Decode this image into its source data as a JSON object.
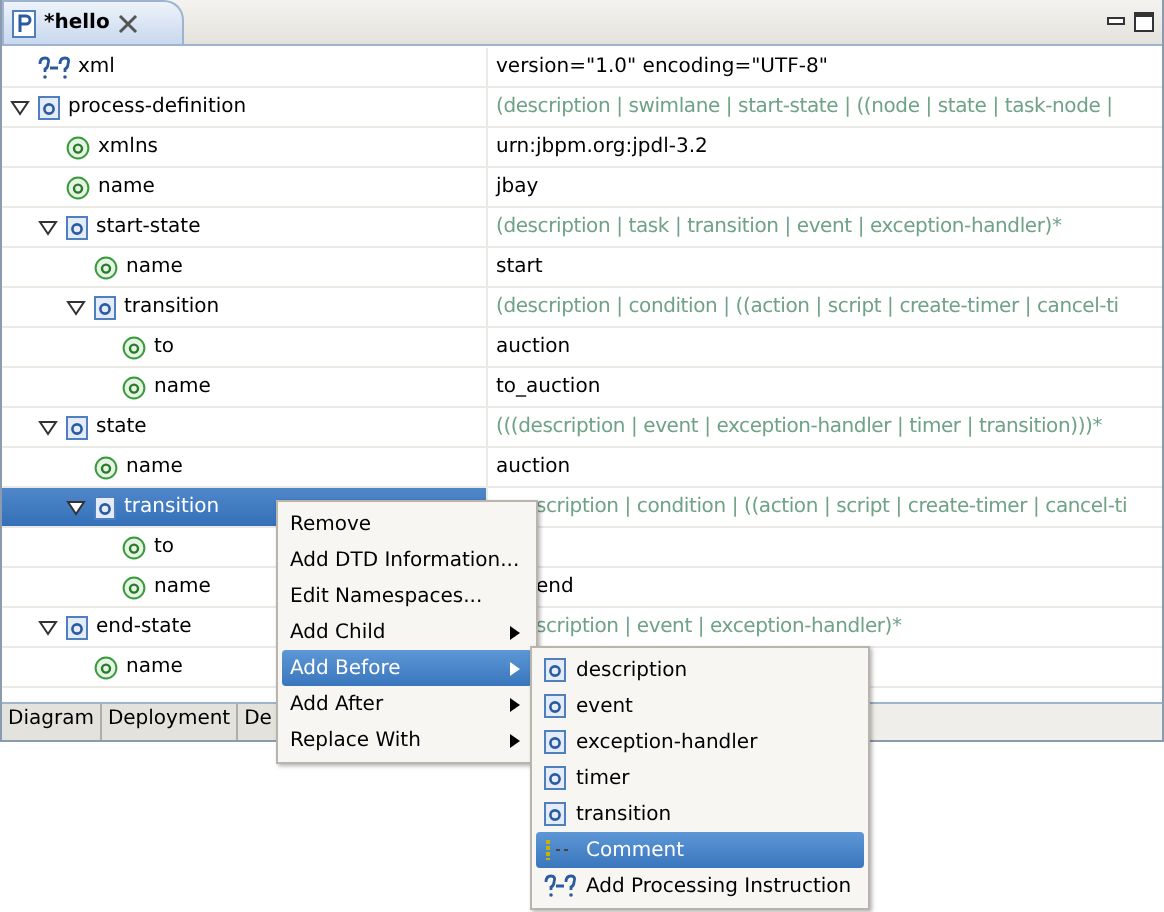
{
  "editor_tab": {
    "title": "*hello",
    "selected": true
  },
  "tree": [
    {
      "kind": "pi",
      "name": "xml",
      "value": "version=\"1.0\" encoding=\"UTF-8\"",
      "selected": false
    },
    {
      "kind": "element",
      "name": "process-definition",
      "value": "(description | swimlane | start-state | ((node | state | task-node |",
      "expanded": true,
      "selected": false,
      "children": [
        {
          "kind": "attribute",
          "name": "xmlns",
          "value": "urn:jbpm.org:jpdl-3.2",
          "selected": false
        },
        {
          "kind": "attribute",
          "name": "name",
          "value": "jbay",
          "selected": false
        },
        {
          "kind": "element",
          "name": "start-state",
          "value": "(description | task | transition | event | exception-handler)*",
          "expanded": true,
          "selected": false,
          "children": [
            {
              "kind": "attribute",
              "name": "name",
              "value": "start",
              "selected": false
            },
            {
              "kind": "element",
              "name": "transition",
              "value": "(description | condition | ((action | script | create-timer | cancel-ti",
              "expanded": true,
              "selected": false,
              "children": [
                {
                  "kind": "attribute",
                  "name": "to",
                  "value": "auction",
                  "selected": false
                },
                {
                  "kind": "attribute",
                  "name": "name",
                  "value": "to_auction",
                  "selected": false
                }
              ]
            }
          ]
        },
        {
          "kind": "element",
          "name": "state",
          "value": "(((description | event | exception-handler | timer | transition)))*",
          "expanded": true,
          "selected": false,
          "children": [
            {
              "kind": "attribute",
              "name": "name",
              "value": "auction",
              "selected": false
            },
            {
              "kind": "element",
              "name": "transition",
              "value": "scription | condition | ((action | script | create-timer | cancel-ti",
              "covered": true,
              "expanded": true,
              "selected": true,
              "children": [
                {
                  "kind": "attribute",
                  "name": "to",
                  "selected": false
                },
                {
                  "kind": "attribute",
                  "name": "name",
                  "value": "end",
                  "covered": true,
                  "selected": false
                }
              ]
            }
          ]
        },
        {
          "kind": "element",
          "name": "end-state",
          "value": "scription | event | exception-handler)*",
          "covered": true,
          "expanded": true,
          "selected": false,
          "children": [
            {
              "kind": "attribute",
              "name": "name",
              "selected": false
            }
          ]
        }
      ]
    }
  ],
  "bottom_tabs": [
    {
      "label": "Diagram",
      "selected": false
    },
    {
      "label": "Deployment",
      "selected": false
    },
    {
      "label": "De",
      "selected": false
    }
  ],
  "context_menu": [
    {
      "label": "Remove",
      "submenu": false,
      "selected": false
    },
    {
      "label": "Add DTD Information...",
      "submenu": false,
      "selected": false
    },
    {
      "label": "Edit Namespaces...",
      "submenu": false,
      "selected": false
    },
    {
      "label": "Add Child",
      "submenu": true,
      "selected": false
    },
    {
      "label": "Add Before",
      "submenu": true,
      "selected": true
    },
    {
      "label": "Add After",
      "submenu": true,
      "selected": false
    },
    {
      "label": "Replace With",
      "submenu": true,
      "selected": false
    }
  ],
  "submenu": [
    {
      "kind": "element",
      "label": "description",
      "selected": false
    },
    {
      "kind": "element",
      "label": "event",
      "selected": false
    },
    {
      "kind": "element",
      "label": "exception-handler",
      "selected": false
    },
    {
      "kind": "element",
      "label": "timer",
      "selected": false
    },
    {
      "kind": "element",
      "label": "transition",
      "selected": false
    },
    {
      "kind": "comment",
      "label": "Comment",
      "selected": true
    },
    {
      "kind": "pi",
      "label": "Add Processing Instruction",
      "selected": false
    }
  ]
}
